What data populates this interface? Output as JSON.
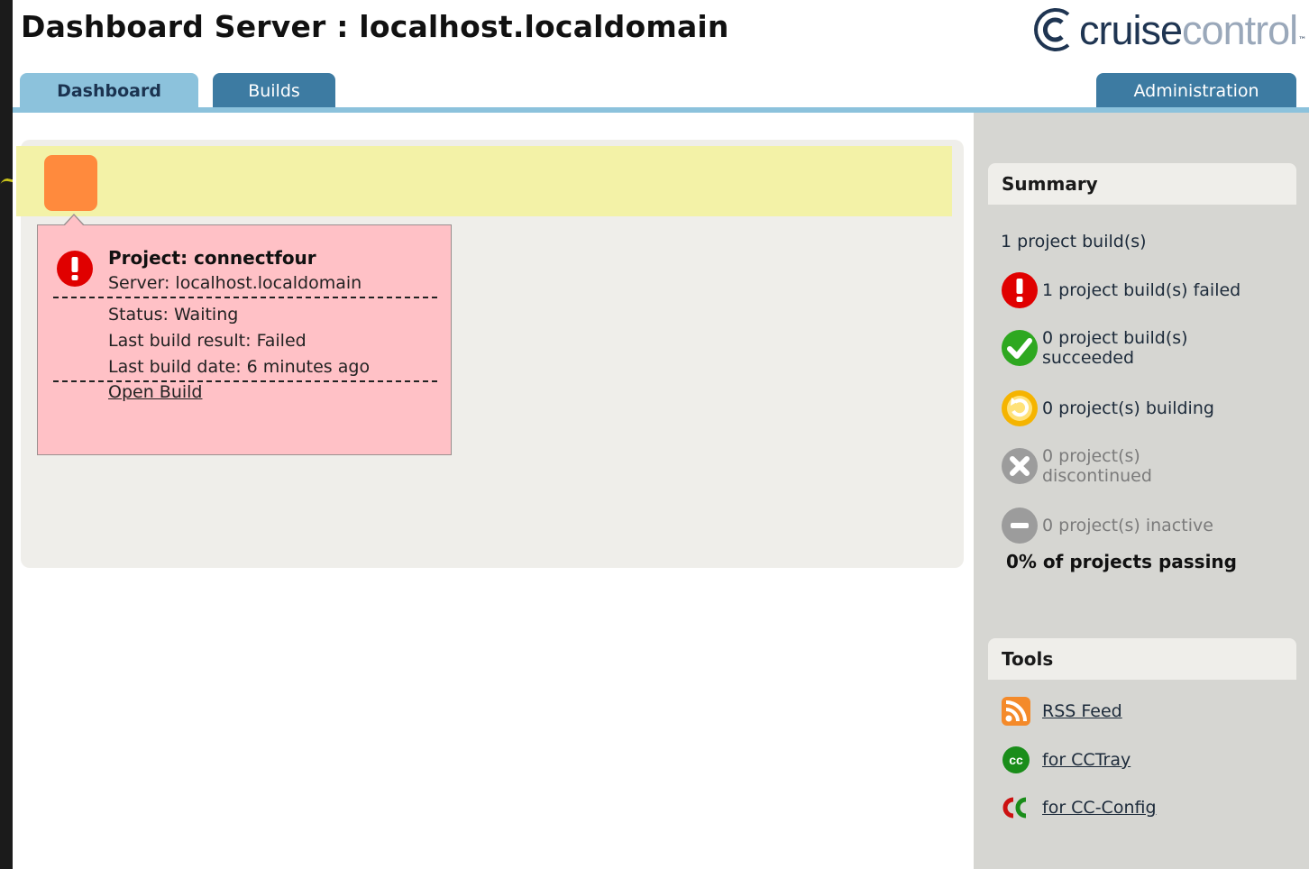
{
  "header": {
    "title": "Dashboard Server : localhost.localdomain",
    "logo": {
      "part1": "cruise",
      "part2": "control",
      "tm": "™",
      "icon": "cruisecontrol-logo-icon"
    }
  },
  "tabs": {
    "dashboard": "Dashboard",
    "builds": "Builds",
    "administration": "Administration"
  },
  "project_popup": {
    "title": "Project: connectfour",
    "server": "Server: localhost.localdomain",
    "status": "Status: Waiting",
    "last_result": "Last build result: Failed",
    "last_date": "Last build date: 6 minutes ago",
    "open_link": "Open Build",
    "tile_color": "#ff8a3d",
    "bg_color": "#ffc1c6"
  },
  "summary": {
    "heading": "Summary",
    "total": "1 project build(s)",
    "failed": "1 project build(s) failed",
    "succeeded_1": "0 project build(s)",
    "succeeded_2": "succeeded",
    "building": "0 project(s) building",
    "discontinued_1": "0 project(s)",
    "discontinued_2": "discontinued",
    "inactive": "0 project(s) inactive",
    "passing": "0% of projects passing"
  },
  "tools": {
    "heading": "Tools",
    "rss": "RSS Feed",
    "cctray": "for CCTray",
    "ccconfig": "for CC-Config"
  },
  "colors": {
    "tab_active": "#8cc2dc",
    "tab_inactive": "#3d7ba2",
    "failed": "#e00000",
    "success": "#2ea820",
    "building": "#f5b400"
  }
}
